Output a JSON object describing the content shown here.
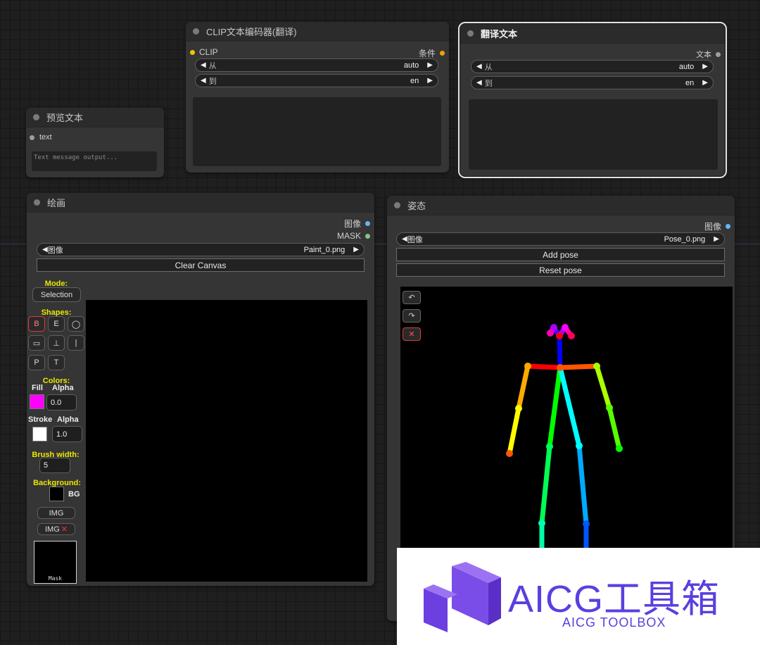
{
  "preview_node": {
    "title": "预览文本",
    "input_label": "text",
    "placeholder": "Text message output..."
  },
  "clip_node": {
    "title": "CLIP文本编码器(翻译)",
    "input_label": "CLIP",
    "output_label": "条件",
    "from_label": "从",
    "from_value": "auto",
    "to_label": "到",
    "to_value": "en"
  },
  "translate_node": {
    "title": "翻译文本",
    "output_label": "文本",
    "from_label": "从",
    "from_value": "auto",
    "to_label": "到",
    "to_value": "en"
  },
  "paint_node": {
    "title": "绘画",
    "output_image": "图像",
    "output_mask": "MASK",
    "image_label": "图像",
    "image_value": "Paint_0.png",
    "clear_button": "Clear Canvas",
    "mode_label": "Mode:",
    "mode_value": "Selection",
    "shapes_label": "Shapes:",
    "shapes": [
      "B",
      "E",
      "◯",
      "▭",
      "⊥",
      "|",
      "P",
      "T"
    ],
    "colors_label": "Colors:",
    "fill_label": "Fill",
    "alpha_label": "Alpha",
    "fill_alpha": "0.0",
    "stroke_label": "Stroke",
    "stroke_alpha": "1.0",
    "fill_color": "#ff00ff",
    "stroke_color": "#ffffff",
    "brush_width_label": "Brush width:",
    "brush_width": "5",
    "background_label": "Background:",
    "bg_label": "BG",
    "img_button": "IMG",
    "img_remove_button": "IMG",
    "img_remove_icon": "✕",
    "mask_label": "Mask"
  },
  "pose_node": {
    "title": "姿态",
    "output_image": "图像",
    "image_label": "图像",
    "image_value": "Pose_0.png",
    "add_pose": "Add pose",
    "reset_pose": "Reset pose",
    "undo_icon": "↶",
    "redo_icon": "↷",
    "delete_icon": "✕"
  },
  "watermark": {
    "title": "AICG工具箱",
    "subtitle": "AICG TOOLBOX",
    "brand_color": "#5a3fe0"
  },
  "colors": {
    "clip_socket": "#f3c400",
    "image_socket": "#64b5f6",
    "mask_socket": "#81c784",
    "text_socket": "#9e9e9e"
  }
}
